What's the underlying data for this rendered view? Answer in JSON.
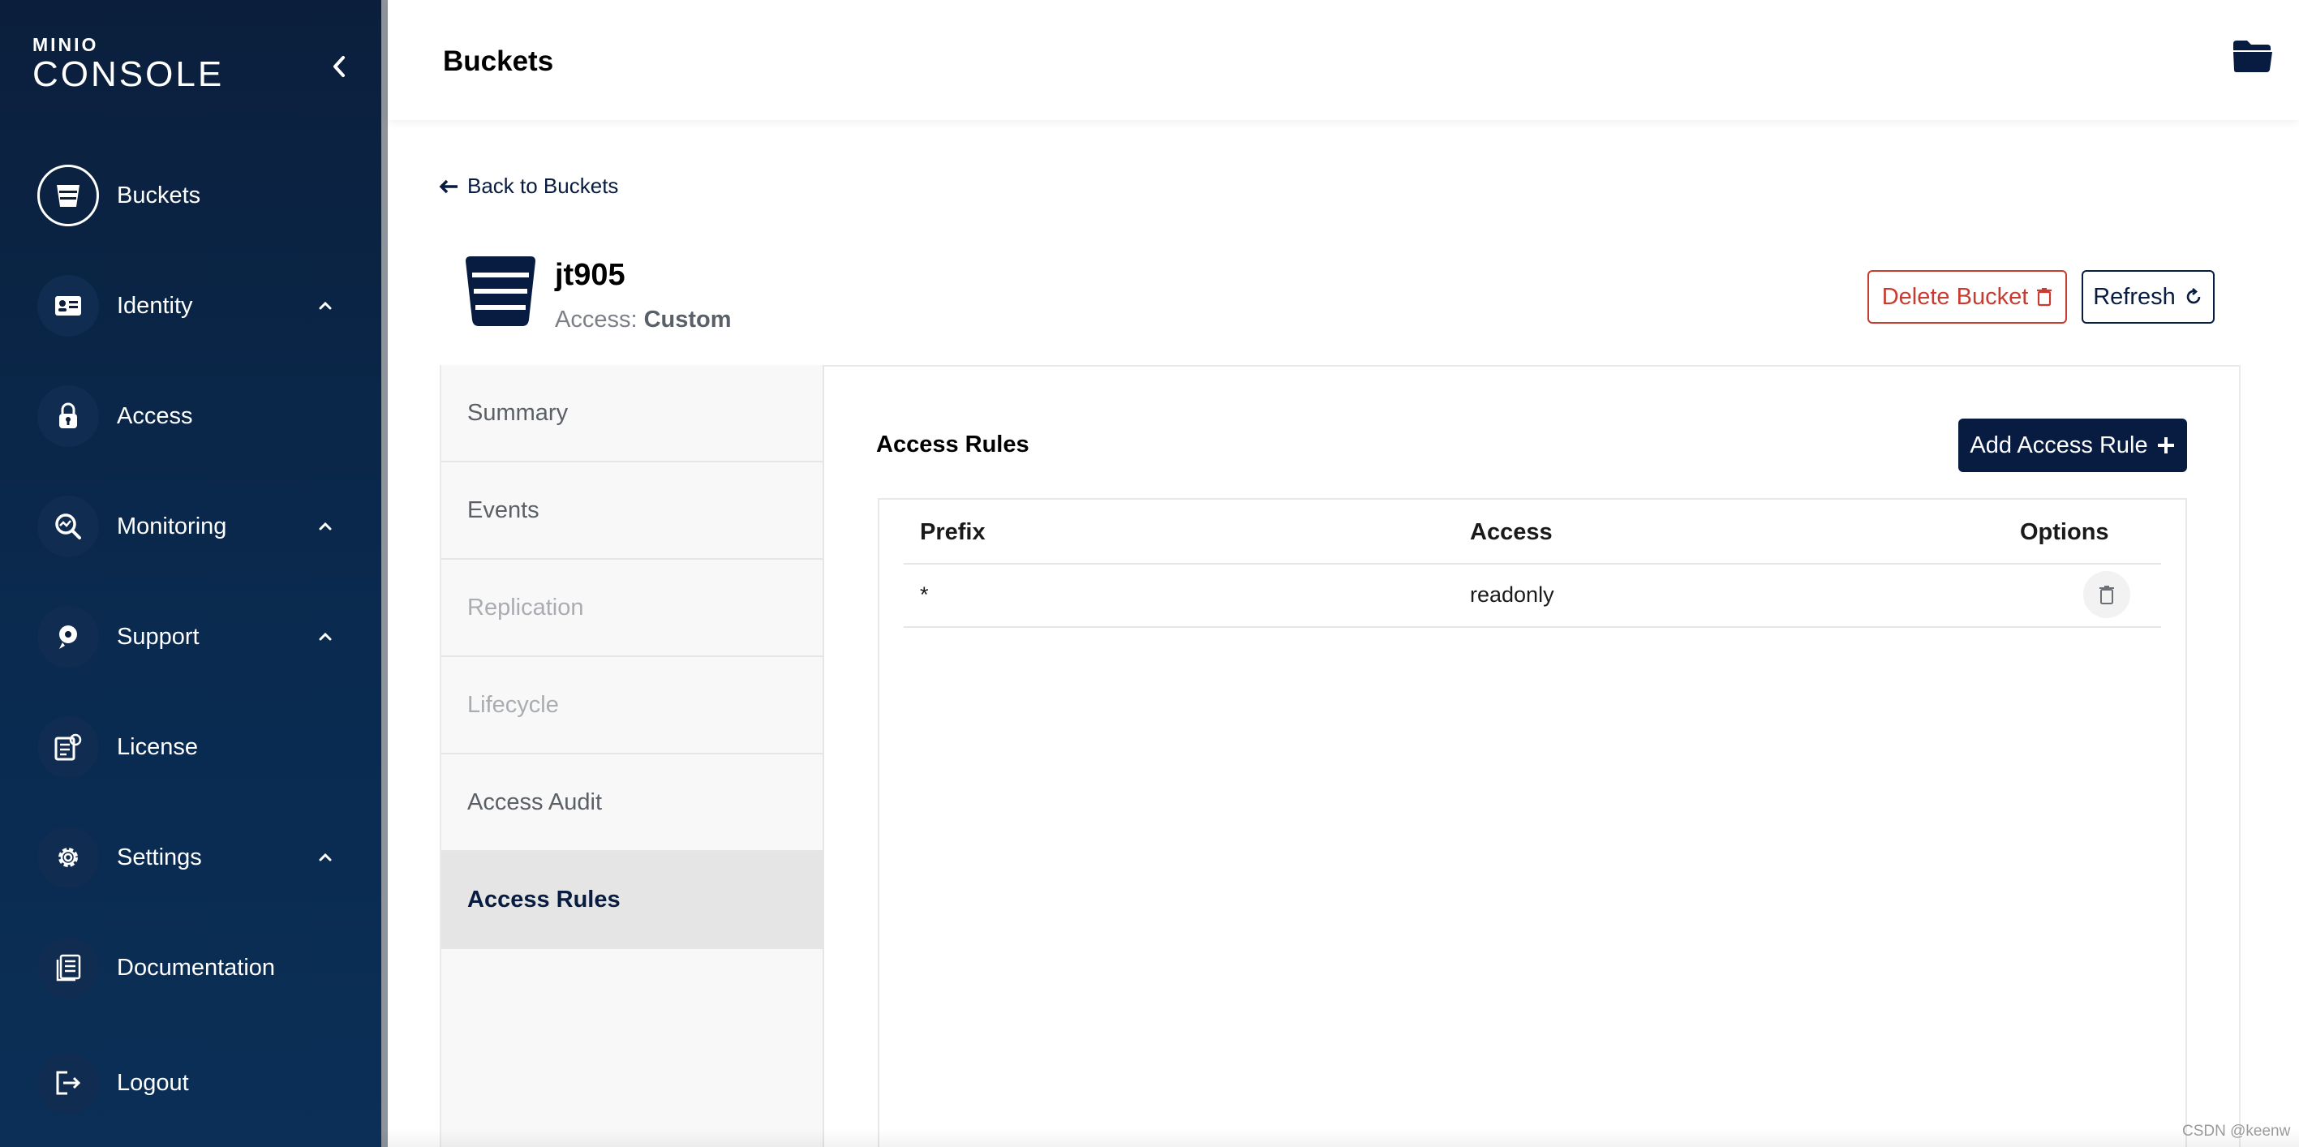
{
  "sidebar": {
    "logo_small": "MINIO",
    "logo_big": "CONSOLE",
    "items": [
      {
        "label": "Buckets",
        "icon": "bucket-icon",
        "active": true,
        "chevron": false
      },
      {
        "label": "Identity",
        "icon": "id-card-icon",
        "active": false,
        "chevron": true
      },
      {
        "label": "Access",
        "icon": "lock-icon",
        "active": false,
        "chevron": false
      },
      {
        "label": "Monitoring",
        "icon": "monitoring-icon",
        "active": false,
        "chevron": true
      },
      {
        "label": "Support",
        "icon": "support-icon",
        "active": false,
        "chevron": true
      },
      {
        "label": "License",
        "icon": "license-icon",
        "active": false,
        "chevron": false
      },
      {
        "label": "Settings",
        "icon": "gear-icon",
        "active": false,
        "chevron": true
      },
      {
        "label": "Documentation",
        "icon": "documentation-icon",
        "active": false,
        "chevron": false
      },
      {
        "label": "Logout",
        "icon": "logout-icon",
        "active": false,
        "chevron": false
      }
    ]
  },
  "header": {
    "title": "Buckets"
  },
  "main": {
    "back_label": "Back to Buckets",
    "bucket_name": "jt905",
    "access_prefix": "Access: ",
    "access_value": "Custom",
    "delete_label": "Delete Bucket",
    "refresh_label": "Refresh",
    "tabs": [
      {
        "label": "Summary",
        "state": "normal"
      },
      {
        "label": "Events",
        "state": "normal"
      },
      {
        "label": "Replication",
        "state": "disabled"
      },
      {
        "label": "Lifecycle",
        "state": "disabled"
      },
      {
        "label": "Access Audit",
        "state": "normal"
      },
      {
        "label": "Access Rules",
        "state": "active"
      }
    ],
    "section_title": "Access Rules",
    "add_label": "Add Access Rule",
    "table": {
      "columns": [
        "Prefix",
        "Access",
        "Options"
      ],
      "rows": [
        {
          "prefix": "*",
          "access": "readonly"
        }
      ]
    }
  },
  "watermark": "CSDN @keenw",
  "colors": {
    "sidebar_bg": "#0b1f3c",
    "accent": "#081c42",
    "danger": "#c83b31"
  }
}
